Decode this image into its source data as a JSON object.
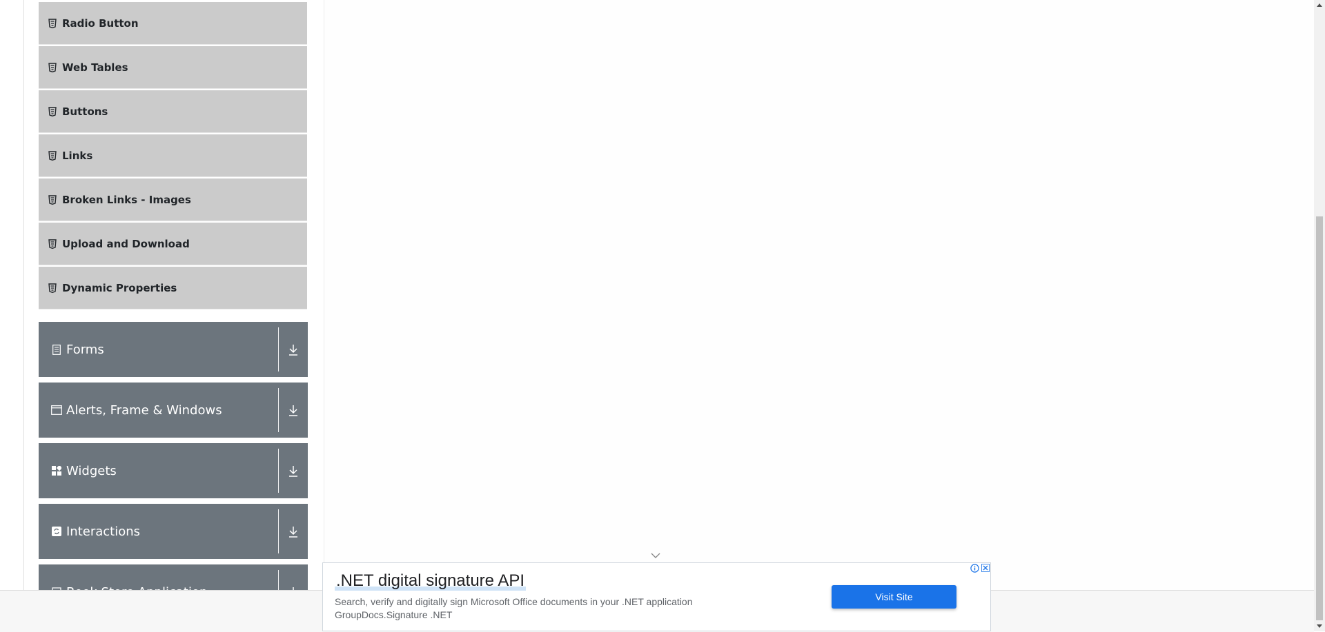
{
  "sidebar": {
    "items": [
      {
        "label": "Radio Button"
      },
      {
        "label": "Web Tables"
      },
      {
        "label": "Buttons"
      },
      {
        "label": "Links"
      },
      {
        "label": "Broken Links - Images"
      },
      {
        "label": "Upload and Download"
      },
      {
        "label": "Dynamic Properties"
      }
    ],
    "groups": [
      {
        "label": "Forms",
        "icon": "form-icon"
      },
      {
        "label": "Alerts, Frame & Windows",
        "icon": "window-icon"
      },
      {
        "label": "Widgets",
        "icon": "widgets-icon"
      },
      {
        "label": "Interactions",
        "icon": "interactions-icon"
      },
      {
        "label": "Book Store Application",
        "icon": "book-store-icon"
      }
    ]
  },
  "ad": {
    "title": ".NET digital signature API",
    "description": "Search, verify and digitally sign Microsoft Office documents in your .NET application",
    "advertiser": "GroupDocs.Signature .NET",
    "button_label": "Visit Site"
  },
  "colors": {
    "sidebar_item_bg": "#cbcbcb",
    "group_header_bg": "#6c757d",
    "ad_button": "#1a73e8",
    "text_dark": "#212529"
  }
}
